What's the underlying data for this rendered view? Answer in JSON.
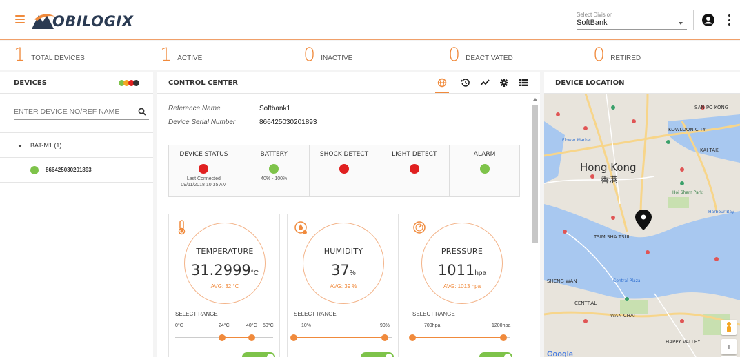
{
  "header": {
    "logo_text": "OBILOGIX",
    "division_label": "Select Division",
    "division_value": "SoftBank"
  },
  "stats": [
    {
      "count": "1",
      "label": "TOTAL DEVICES"
    },
    {
      "count": "1",
      "label": "ACTIVE"
    },
    {
      "count": "0",
      "label": "INACTIVE"
    },
    {
      "count": "0",
      "label": "DEACTIVATED"
    },
    {
      "count": "0",
      "label": "RETIRED"
    }
  ],
  "devices": {
    "title": "DEVICES",
    "search_placeholder": "ENTER DEVICE NO/REF NAME",
    "group_label": "BAT-M1 (1)",
    "device_id": "866425030201893",
    "legend_colors": [
      "#7ec34a",
      "#f5a623",
      "#e02020",
      "#333333"
    ]
  },
  "control": {
    "title": "CONTROL CENTER",
    "reference_label": "Reference Name",
    "reference_value": "Softbank1",
    "serial_label": "Device Serial Number",
    "serial_value": "866425030201893",
    "status": [
      {
        "title": "DEVICE STATUS",
        "color": "#e02020",
        "sub1": "Last Connected",
        "sub2": "09/11/2018 10:35 AM"
      },
      {
        "title": "BATTERY",
        "color": "#7ec34a",
        "sub1": "40% - 100%",
        "sub2": ""
      },
      {
        "title": "SHOCK DETECT",
        "color": "#e02020",
        "sub1": "",
        "sub2": ""
      },
      {
        "title": "LIGHT DETECT",
        "color": "#e02020",
        "sub1": "",
        "sub2": ""
      },
      {
        "title": "ALARM",
        "color": "#7ec34a",
        "sub1": "",
        "sub2": ""
      }
    ],
    "sensors": [
      {
        "title": "TEMPERATURE",
        "value": "31.2999",
        "unit": "°C",
        "avg": "AVG: 32 °C",
        "range_label": "SELECT RANGE",
        "min": "0°C",
        "mid1": "24°C",
        "mid2": "40°C",
        "max": "50°C",
        "low_pct": 0.48,
        "high_pct": 0.78
      },
      {
        "title": "HUMIDITY",
        "value": "37",
        "unit": "%",
        "avg": "AVG: 39 %",
        "range_label": "SELECT RANGE",
        "min": "10%",
        "mid1": "",
        "mid2": "",
        "max": "90%",
        "low_pct": 0.0,
        "high_pct": 0.93
      },
      {
        "title": "PRESSURE",
        "value": "1011",
        "unit": "hpa",
        "avg": "AVG: 1013 hpa",
        "range_label": "SELECT RANGE",
        "min": "700hpa",
        "mid1": "",
        "mid2": "",
        "max": "1200hpa",
        "low_pct": 0.0,
        "high_pct": 0.93
      }
    ]
  },
  "location": {
    "title": "DEVICE LOCATION",
    "city": "Hong Kong",
    "city_cn": "香港",
    "labels": [
      "SAN PO KONG",
      "KOWLOON CITY",
      "KAI TAK",
      "Flower Market",
      "Hoi Sham Park",
      "Hoi Sham Park",
      "Harbour Bay",
      "TSIM SHA TSUI",
      "Central Plaza",
      "CENTRAL",
      "WAN CHAI",
      "HAPPY VALLEY",
      "SHENG WAN"
    ],
    "google": "Google",
    "zoom_in": "+",
    "zoom_out": "−"
  }
}
